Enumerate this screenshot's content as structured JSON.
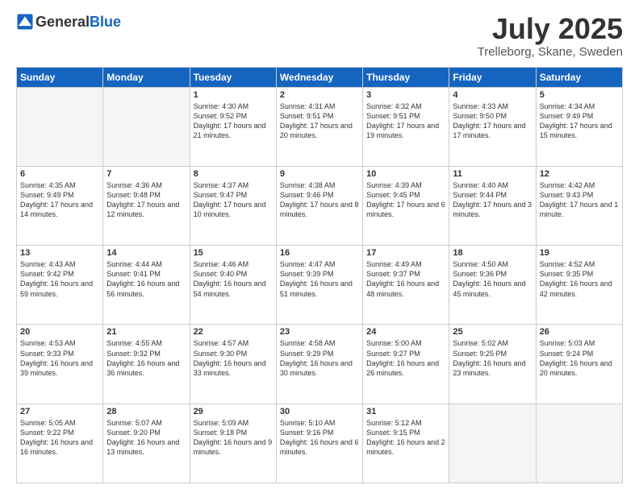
{
  "header": {
    "logo_general": "General",
    "logo_blue": "Blue",
    "month_year": "July 2025",
    "location": "Trelleborg, Skane, Sweden"
  },
  "days_of_week": [
    "Sunday",
    "Monday",
    "Tuesday",
    "Wednesday",
    "Thursday",
    "Friday",
    "Saturday"
  ],
  "weeks": [
    [
      {
        "day": "",
        "info": ""
      },
      {
        "day": "",
        "info": ""
      },
      {
        "day": "1",
        "info": "Sunrise: 4:30 AM\nSunset: 9:52 PM\nDaylight: 17 hours and 21 minutes."
      },
      {
        "day": "2",
        "info": "Sunrise: 4:31 AM\nSunset: 9:51 PM\nDaylight: 17 hours and 20 minutes."
      },
      {
        "day": "3",
        "info": "Sunrise: 4:32 AM\nSunset: 9:51 PM\nDaylight: 17 hours and 19 minutes."
      },
      {
        "day": "4",
        "info": "Sunrise: 4:33 AM\nSunset: 9:50 PM\nDaylight: 17 hours and 17 minutes."
      },
      {
        "day": "5",
        "info": "Sunrise: 4:34 AM\nSunset: 9:49 PM\nDaylight: 17 hours and 15 minutes."
      }
    ],
    [
      {
        "day": "6",
        "info": "Sunrise: 4:35 AM\nSunset: 9:49 PM\nDaylight: 17 hours and 14 minutes."
      },
      {
        "day": "7",
        "info": "Sunrise: 4:36 AM\nSunset: 9:48 PM\nDaylight: 17 hours and 12 minutes."
      },
      {
        "day": "8",
        "info": "Sunrise: 4:37 AM\nSunset: 9:47 PM\nDaylight: 17 hours and 10 minutes."
      },
      {
        "day": "9",
        "info": "Sunrise: 4:38 AM\nSunset: 9:46 PM\nDaylight: 17 hours and 8 minutes."
      },
      {
        "day": "10",
        "info": "Sunrise: 4:39 AM\nSunset: 9:45 PM\nDaylight: 17 hours and 6 minutes."
      },
      {
        "day": "11",
        "info": "Sunrise: 4:40 AM\nSunset: 9:44 PM\nDaylight: 17 hours and 3 minutes."
      },
      {
        "day": "12",
        "info": "Sunrise: 4:42 AM\nSunset: 9:43 PM\nDaylight: 17 hours and 1 minute."
      }
    ],
    [
      {
        "day": "13",
        "info": "Sunrise: 4:43 AM\nSunset: 9:42 PM\nDaylight: 16 hours and 59 minutes."
      },
      {
        "day": "14",
        "info": "Sunrise: 4:44 AM\nSunset: 9:41 PM\nDaylight: 16 hours and 56 minutes."
      },
      {
        "day": "15",
        "info": "Sunrise: 4:46 AM\nSunset: 9:40 PM\nDaylight: 16 hours and 54 minutes."
      },
      {
        "day": "16",
        "info": "Sunrise: 4:47 AM\nSunset: 9:39 PM\nDaylight: 16 hours and 51 minutes."
      },
      {
        "day": "17",
        "info": "Sunrise: 4:49 AM\nSunset: 9:37 PM\nDaylight: 16 hours and 48 minutes."
      },
      {
        "day": "18",
        "info": "Sunrise: 4:50 AM\nSunset: 9:36 PM\nDaylight: 16 hours and 45 minutes."
      },
      {
        "day": "19",
        "info": "Sunrise: 4:52 AM\nSunset: 9:35 PM\nDaylight: 16 hours and 42 minutes."
      }
    ],
    [
      {
        "day": "20",
        "info": "Sunrise: 4:53 AM\nSunset: 9:33 PM\nDaylight: 16 hours and 39 minutes."
      },
      {
        "day": "21",
        "info": "Sunrise: 4:55 AM\nSunset: 9:32 PM\nDaylight: 16 hours and 36 minutes."
      },
      {
        "day": "22",
        "info": "Sunrise: 4:57 AM\nSunset: 9:30 PM\nDaylight: 16 hours and 33 minutes."
      },
      {
        "day": "23",
        "info": "Sunrise: 4:58 AM\nSunset: 9:29 PM\nDaylight: 16 hours and 30 minutes."
      },
      {
        "day": "24",
        "info": "Sunrise: 5:00 AM\nSunset: 9:27 PM\nDaylight: 16 hours and 26 minutes."
      },
      {
        "day": "25",
        "info": "Sunrise: 5:02 AM\nSunset: 9:25 PM\nDaylight: 16 hours and 23 minutes."
      },
      {
        "day": "26",
        "info": "Sunrise: 5:03 AM\nSunset: 9:24 PM\nDaylight: 16 hours and 20 minutes."
      }
    ],
    [
      {
        "day": "27",
        "info": "Sunrise: 5:05 AM\nSunset: 9:22 PM\nDaylight: 16 hours and 16 minutes."
      },
      {
        "day": "28",
        "info": "Sunrise: 5:07 AM\nSunset: 9:20 PM\nDaylight: 16 hours and 13 minutes."
      },
      {
        "day": "29",
        "info": "Sunrise: 5:09 AM\nSunset: 9:18 PM\nDaylight: 16 hours and 9 minutes."
      },
      {
        "day": "30",
        "info": "Sunrise: 5:10 AM\nSunset: 9:16 PM\nDaylight: 16 hours and 6 minutes."
      },
      {
        "day": "31",
        "info": "Sunrise: 5:12 AM\nSunset: 9:15 PM\nDaylight: 16 hours and 2 minutes."
      },
      {
        "day": "",
        "info": ""
      },
      {
        "day": "",
        "info": ""
      }
    ]
  ]
}
